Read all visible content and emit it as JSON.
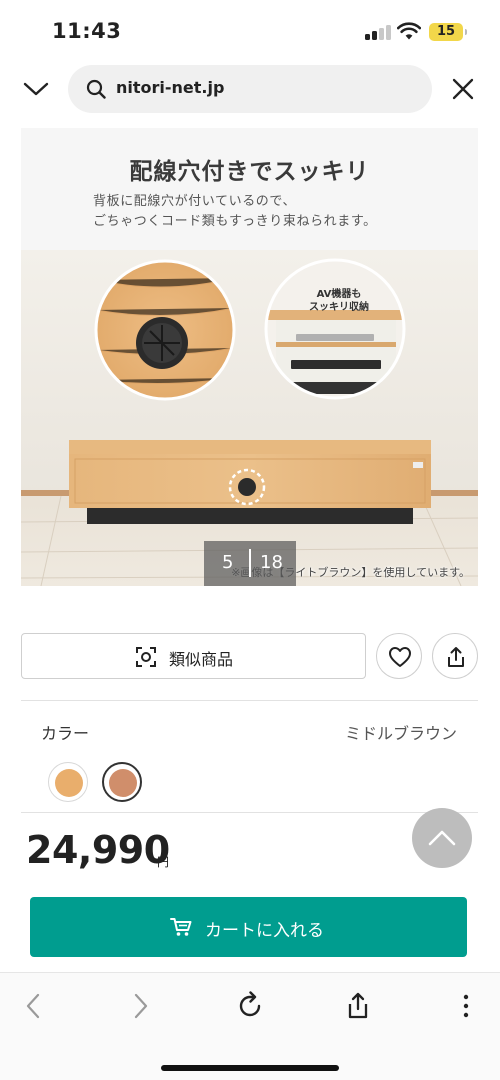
{
  "status": {
    "time": "11:43",
    "battery": "15"
  },
  "browser": {
    "url": "nitori-net.jp"
  },
  "hero": {
    "title": "配線穴付きでスッキリ",
    "desc_line1": "背板に配線穴が付いているので、",
    "desc_line2": "ごちゃつくコード類もすっきり束ねられます。",
    "badge_line1": "AV機器も",
    "badge_line2": "スッキリ収納",
    "note": "※画像は【ライトブラウン】を使用しています。",
    "current_slide": "5",
    "total_slides": "18"
  },
  "actions": {
    "similar_label": "類似商品",
    "favorite_icon": "heart-icon",
    "share_icon": "share-icon"
  },
  "color": {
    "label": "カラー",
    "selected": "ミドルブラウン",
    "swatches": [
      {
        "name": "light-brown",
        "hex": "#e9ae6c",
        "selected": false
      },
      {
        "name": "middle-brown",
        "hex": "#d08e6b",
        "selected": true
      }
    ]
  },
  "price": {
    "value": "24,990",
    "unit": "円"
  },
  "cart": {
    "label": "カートに入れる",
    "color": "#009d8f"
  },
  "toolbar": {
    "icons": [
      "back-icon",
      "forward-icon",
      "reload-icon",
      "share-icon",
      "more-icon"
    ]
  }
}
